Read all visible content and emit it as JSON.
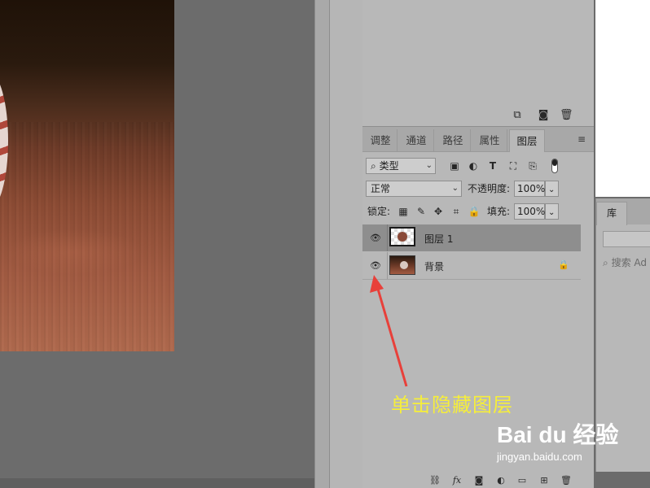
{
  "panel_tabs": [
    {
      "label": "调整"
    },
    {
      "label": "通道"
    },
    {
      "label": "路径"
    },
    {
      "label": "属性"
    },
    {
      "label": "图层",
      "active": true
    }
  ],
  "filter": {
    "kind_label": "类型"
  },
  "blend": {
    "mode": "正常",
    "opacity_label": "不透明度:",
    "opacity_value": "100%"
  },
  "lock": {
    "label": "锁定:",
    "fill_label": "填充:",
    "fill_value": "100%"
  },
  "layers": [
    {
      "name": "图层 1",
      "visible": true,
      "selected": true
    },
    {
      "name": "背景",
      "visible": true,
      "locked": true
    }
  ],
  "library": {
    "tab_label": "库",
    "search_placeholder": "搜索 Ad"
  },
  "annotation": {
    "text": "单击隐藏图层",
    "color": "#f6ee3a"
  },
  "watermark": {
    "brand": "Bai du 经验",
    "url": "jingyan.baidu.com"
  },
  "colors": {
    "panel_bg": "#b8b8b8",
    "canvas_bg": "#6c6c6c",
    "arrow": "#e8403a"
  },
  "icons": {
    "history_footer": [
      "new-snapshot-icon",
      "camera-icon",
      "trash-icon"
    ],
    "filter_types": [
      "image-filter-icon",
      "adjustment-filter-icon",
      "type-filter-icon",
      "shape-filter-icon",
      "smart-object-filter-icon",
      "filter-toggle-icon"
    ],
    "lock_types": [
      "lock-transparent-icon",
      "lock-pixels-icon",
      "lock-position-icon",
      "lock-artboard-icon",
      "lock-all-icon"
    ],
    "layers_footer": [
      "link-icon",
      "fx-icon",
      "mask-icon",
      "adjustment-icon",
      "group-icon",
      "new-layer-icon",
      "trash-icon"
    ]
  }
}
